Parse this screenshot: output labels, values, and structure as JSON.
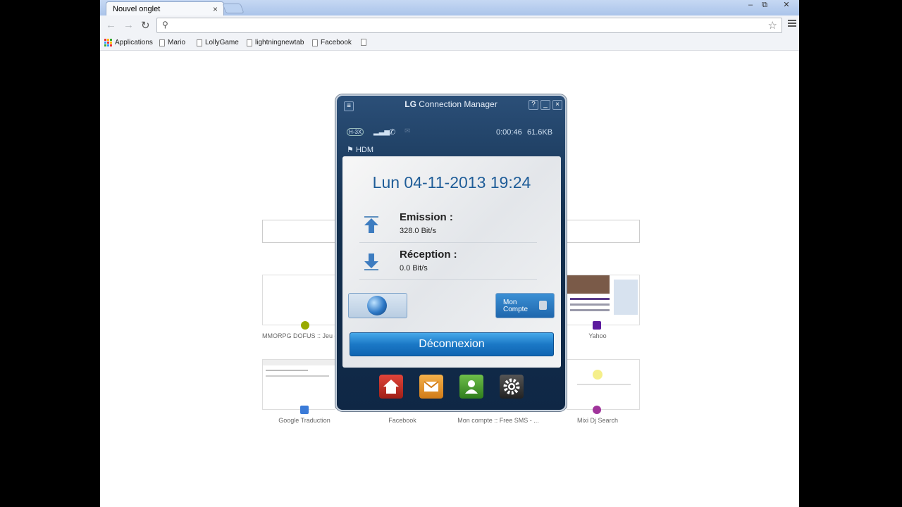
{
  "browser": {
    "tab_title": "Nouvel onglet",
    "tab_close": "×",
    "window_buttons": {
      "minimize": "–",
      "restore": "⧉",
      "close": "✕"
    },
    "bookmarks": [
      "Applications",
      "Mario",
      "LollyGame",
      "lightningnewtab",
      "Facebook"
    ]
  },
  "ntp": {
    "thumbnails": [
      {
        "label": "MMORPG DOFUS :: Jeu d"
      },
      {
        "label": "Yahoo"
      },
      {
        "label": "Google Traduction"
      },
      {
        "label": "Facebook"
      },
      {
        "label": "Mon compte :: Free SMS - ..."
      },
      {
        "label": "Mixi Dj Search"
      }
    ]
  },
  "lg": {
    "title_brand": "LG",
    "title_rest": "Connection Manager",
    "help": "?",
    "minimize": "_",
    "close": "×",
    "network": "H-3X",
    "timer": "0:00:46",
    "data_used": "61.6KB",
    "profile": "HDM",
    "datetime": "Lun 04-11-2013 19:24",
    "emission_label": "Emission :",
    "emission_value": "328.0 Bit/s",
    "reception_label": "Réception :",
    "reception_value": "0.0 Bit/s",
    "account_line1": "Mon",
    "account_line2": "Compte",
    "disconnect": "Déconnexion"
  }
}
